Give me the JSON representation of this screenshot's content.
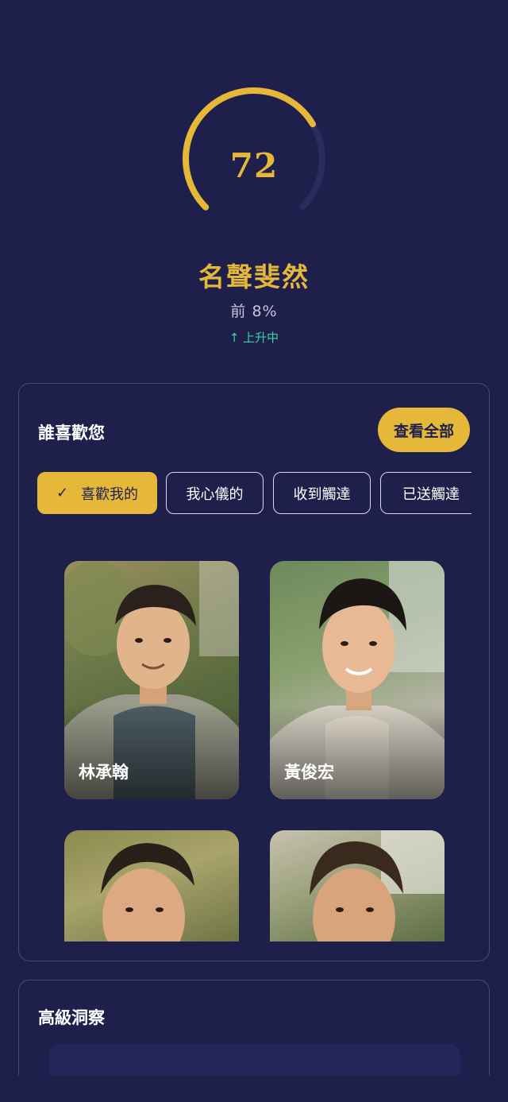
{
  "score": {
    "value": "72",
    "progress_fraction": 0.72,
    "arc_color": "#e5b83a",
    "track_color": "#2b2c5c"
  },
  "rank": {
    "title": "名聲斐然",
    "percentile": "前 8%",
    "trend_icon": "arrow-up-icon",
    "trend_label": "↑ 上升中"
  },
  "likes_section": {
    "title": "誰喜歡您",
    "view_all_label": "查看全部",
    "tabs": [
      {
        "label": "喜歡我的",
        "active": true,
        "icon": "check-icon"
      },
      {
        "label": "我心儀的",
        "active": false
      },
      {
        "label": "收到觸達",
        "active": false
      },
      {
        "label": "已送觸達",
        "active": false
      }
    ],
    "people": [
      {
        "name": "林承翰"
      },
      {
        "name": "黃俊宏"
      },
      {
        "name": ""
      },
      {
        "name": ""
      }
    ]
  },
  "insights_section": {
    "title": "高級洞察"
  },
  "colors": {
    "background": "#1e1f4b",
    "accent_gold": "#e5b83a",
    "trend_green": "#35d6a4",
    "card_border": "#4a4c78"
  }
}
